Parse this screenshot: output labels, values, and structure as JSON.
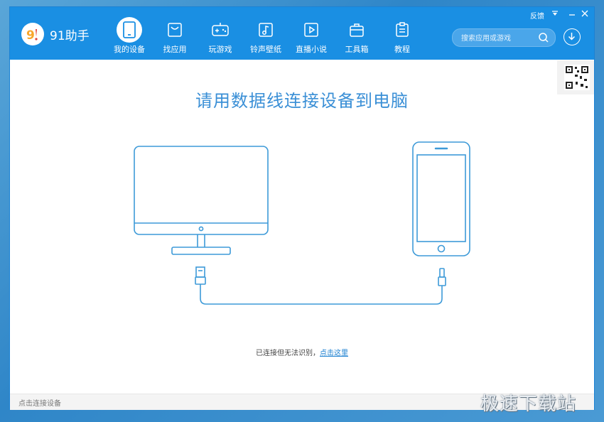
{
  "app": {
    "name": "91助手"
  },
  "window": {
    "feedback_label": "反馈"
  },
  "nav": {
    "items": [
      {
        "label": "我的设备",
        "icon": "tablet-icon",
        "active": true
      },
      {
        "label": "找应用",
        "icon": "bag-icon"
      },
      {
        "label": "玩游戏",
        "icon": "gamepad-icon"
      },
      {
        "label": "铃声壁纸",
        "icon": "music-icon"
      },
      {
        "label": "直播小说",
        "icon": "play-icon"
      },
      {
        "label": "工具箱",
        "icon": "toolbox-icon"
      },
      {
        "label": "教程",
        "icon": "clipboard-icon"
      }
    ]
  },
  "search": {
    "placeholder": "搜索应用或游戏"
  },
  "main": {
    "headline": "请用数据线连接设备到电脑",
    "notice_text": "已连接但无法识别，",
    "notice_link": "点击这里"
  },
  "status": {
    "text": "点击连接设备"
  },
  "watermark": {
    "text": "极速下载站"
  },
  "colors": {
    "accent": "#1a8fe3",
    "headline": "#3a8fd6",
    "line": "#3d9ad8"
  }
}
